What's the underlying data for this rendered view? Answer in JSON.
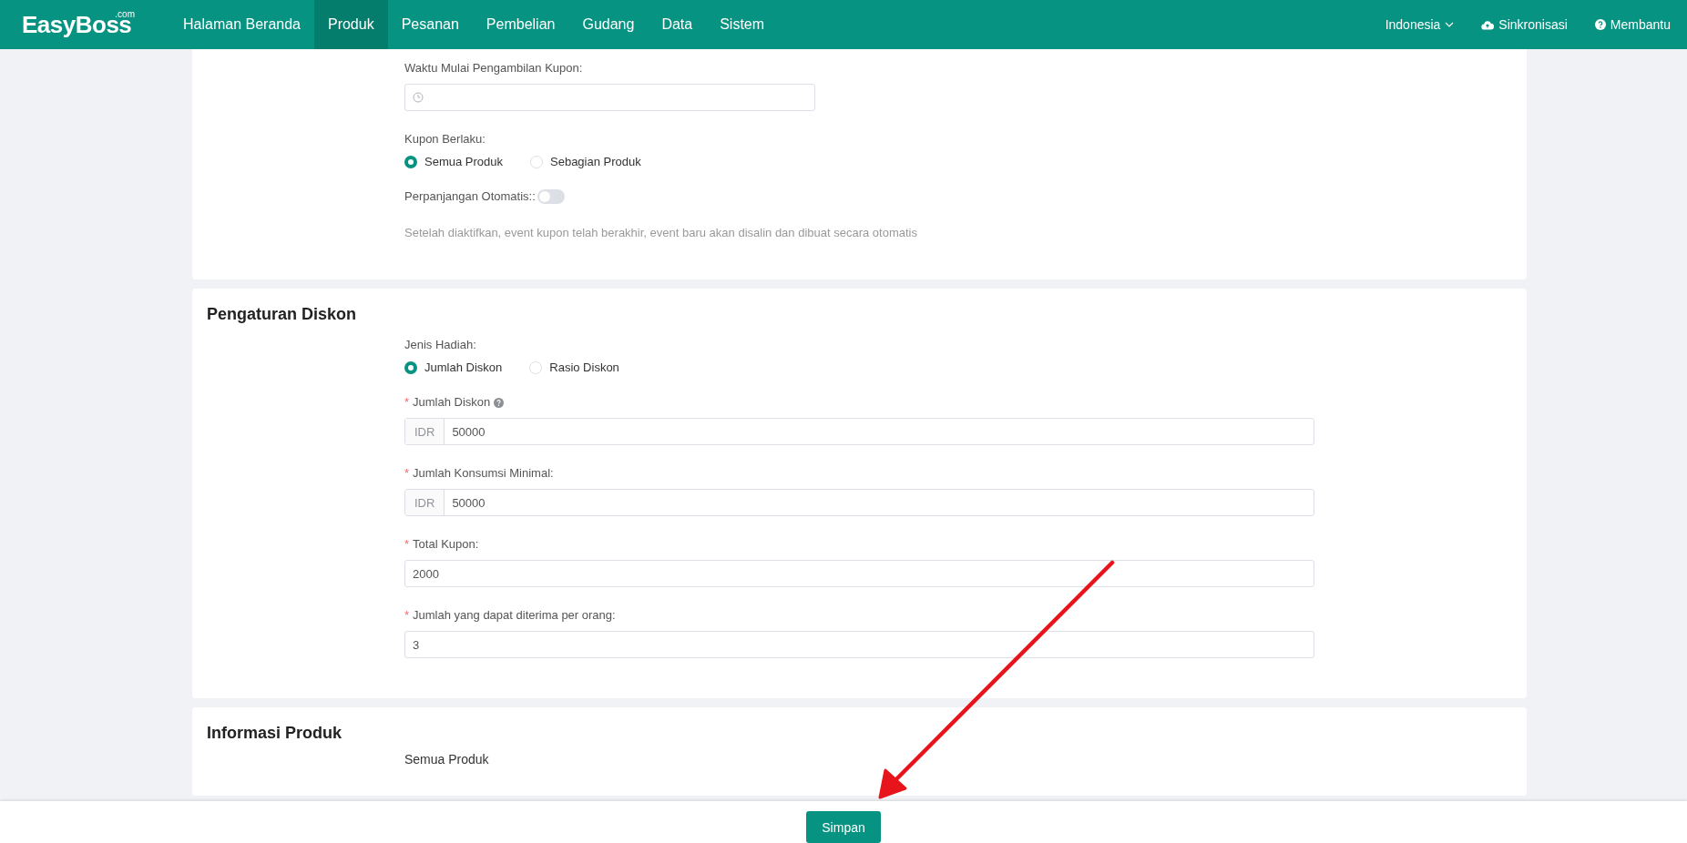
{
  "header": {
    "logo": "EasyBoss",
    "logo_suffix": ".com",
    "nav": [
      {
        "label": "Halaman Beranda",
        "selected": false
      },
      {
        "label": "Produk",
        "selected": true
      },
      {
        "label": "Pesanan",
        "selected": false
      },
      {
        "label": "Pembelian",
        "selected": false
      },
      {
        "label": "Gudang",
        "selected": false
      },
      {
        "label": "Data",
        "selected": false
      },
      {
        "label": "Sistem",
        "selected": false
      }
    ],
    "language": "Indonesia",
    "sync": "Sinkronisasi",
    "help": "Membantu"
  },
  "sections": [
    {
      "fields": [
        {
          "kind": "time",
          "label": "Waktu Mulai Pengambilan Kupon:"
        },
        {
          "kind": "radio",
          "label": "Kupon Berlaku:",
          "options": [
            {
              "label": "Semua Produk",
              "selected": true
            },
            {
              "label": "Sebagian Produk",
              "selected": false
            }
          ]
        },
        {
          "kind": "switch",
          "label": "Perpanjangan Otomatis::",
          "on": false
        },
        {
          "kind": "note",
          "text": "Setelah diaktifkan, event kupon telah berakhir, event baru akan disalin dan dibuat secara otomatis"
        }
      ]
    },
    {
      "title": "Pengaturan Diskon",
      "fields": [
        {
          "kind": "radio",
          "label": "Jenis Hadiah:",
          "options": [
            {
              "label": "Jumlah Diskon",
              "selected": true
            },
            {
              "label": "Rasio Diskon",
              "selected": false
            }
          ]
        },
        {
          "kind": "input",
          "marker": "*",
          "label": "Jumlah Diskon",
          "help": true,
          "prefix": "IDR",
          "value": "50000"
        },
        {
          "kind": "input",
          "marker": "*",
          "label": "Jumlah Konsumsi Minimal:",
          "help": false,
          "prefix": "IDR",
          "value": "50000"
        },
        {
          "kind": "input",
          "marker": "*",
          "label": "Total Kupon:",
          "help": false,
          "value": "2000"
        },
        {
          "kind": "input",
          "marker": "*",
          "label": "Jumlah yang dapat diterima per orang:",
          "help": false,
          "value": "3"
        }
      ]
    },
    {
      "title": "Informasi Produk",
      "fields": [
        {
          "kind": "text",
          "text": "Semua Produk"
        }
      ]
    }
  ],
  "footer": {
    "button": "Simpan"
  }
}
